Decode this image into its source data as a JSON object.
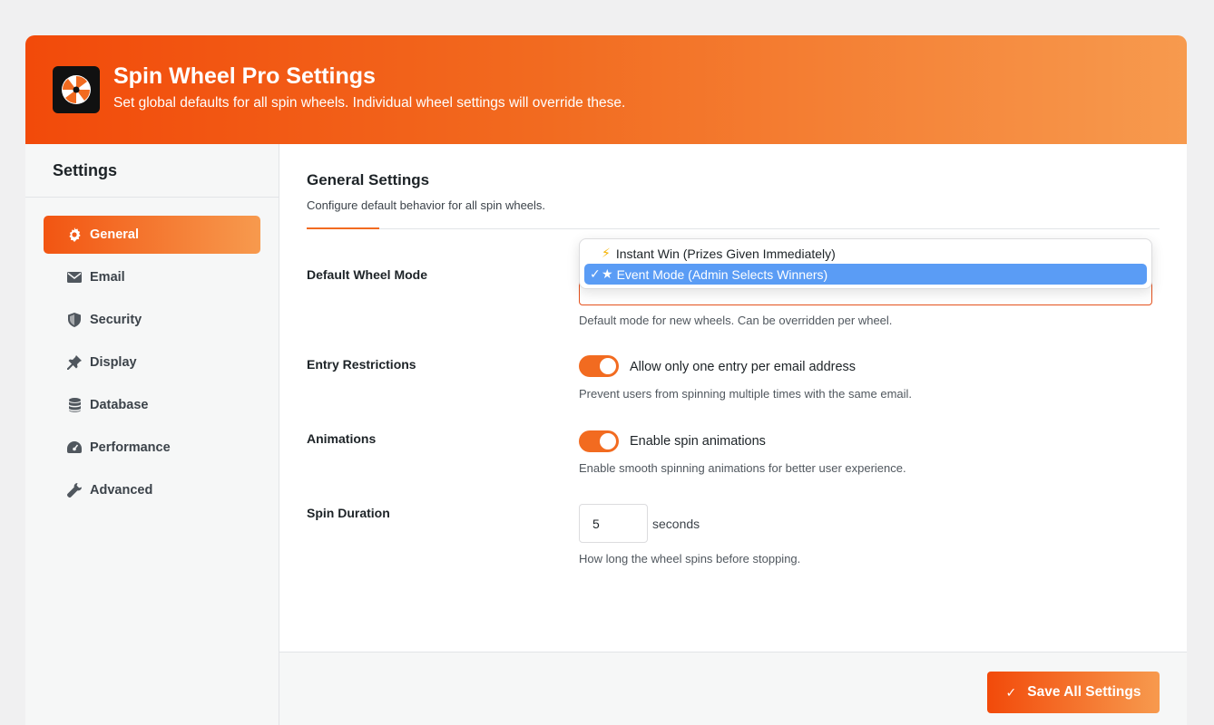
{
  "header": {
    "title": "Spin Wheel Pro Settings",
    "subtitle": "Set global defaults for all spin wheels. Individual wheel settings will override these.",
    "logo_icon": "spin-wheel-icon"
  },
  "sidebar": {
    "title": "Settings",
    "items": [
      {
        "label": "General",
        "icon": "gear-icon",
        "active": true
      },
      {
        "label": "Email",
        "icon": "envelope-icon"
      },
      {
        "label": "Security",
        "icon": "shield-icon"
      },
      {
        "label": "Display",
        "icon": "pin-icon"
      },
      {
        "label": "Database",
        "icon": "database-icon"
      },
      {
        "label": "Performance",
        "icon": "gauge-icon"
      },
      {
        "label": "Advanced",
        "icon": "wrench-icon"
      }
    ]
  },
  "main": {
    "title": "General Settings",
    "description": "Configure default behavior for all spin wheels.",
    "wheel_mode": {
      "label": "Default Wheel Mode",
      "options": [
        {
          "icon": "⚡",
          "label": "Instant Win (Prizes Given Immediately)"
        },
        {
          "icon": "★",
          "label": "Event Mode (Admin Selects Winners)",
          "selected": true
        }
      ],
      "help": "Default mode for new wheels. Can be overridden per wheel."
    },
    "entry_restrictions": {
      "label": "Entry Restrictions",
      "toggle_label": "Allow only one entry per email address",
      "enabled": true,
      "help": "Prevent users from spinning multiple times with the same email."
    },
    "animations": {
      "label": "Animations",
      "toggle_label": "Enable spin animations",
      "enabled": true,
      "help": "Enable smooth spinning animations for better user experience."
    },
    "spin_duration": {
      "label": "Spin Duration",
      "value": "5",
      "unit": "seconds",
      "help": "How long the wheel spins before stopping."
    }
  },
  "footer": {
    "save_label": "Save All Settings",
    "save_icon": "✓"
  },
  "colors": {
    "accent": "#f26b20",
    "accent_dark": "#f24a0a",
    "selected_option": "#5a9cf5"
  }
}
